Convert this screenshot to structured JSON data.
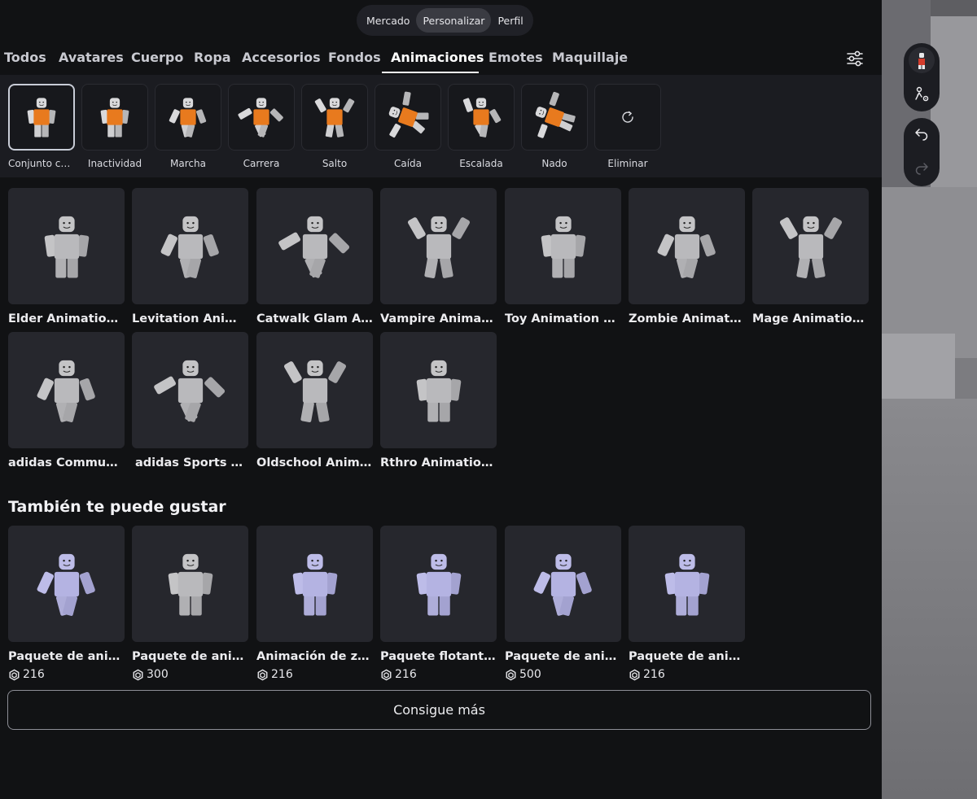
{
  "top_segment": [
    {
      "label": "Mercado",
      "active": false
    },
    {
      "label": "Personalizar",
      "active": true
    },
    {
      "label": "Perfil",
      "active": false
    }
  ],
  "category_tabs": [
    {
      "label": "Todos",
      "active": false
    },
    {
      "label": "Avatares",
      "active": false
    },
    {
      "label": "Cuerpo",
      "active": false
    },
    {
      "label": "Ropa",
      "active": false
    },
    {
      "label": "Accesorios",
      "active": false
    },
    {
      "label": "Fondos",
      "active": false
    },
    {
      "label": "Animaciones",
      "active": true
    },
    {
      "label": "Emotes",
      "active": false
    },
    {
      "label": "Maquillaje",
      "active": false
    }
  ],
  "sub_categories": [
    {
      "label": "Conjunto co...",
      "active": true
    },
    {
      "label": "Inactividad",
      "active": false
    },
    {
      "label": "Marcha",
      "active": false
    },
    {
      "label": "Carrera",
      "active": false
    },
    {
      "label": "Salto",
      "active": false
    },
    {
      "label": "Caída",
      "active": false
    },
    {
      "label": "Escalada",
      "active": false
    },
    {
      "label": "Nado",
      "active": false
    },
    {
      "label": "Eliminar",
      "active": false
    }
  ],
  "owned_items": [
    {
      "name": "Elder Animation P..."
    },
    {
      "name": "Levitation Animati..."
    },
    {
      "name": "Catwalk Glam Ani..."
    },
    {
      "name": "Vampire Animatio..."
    },
    {
      "name": "Toy Animation Pack"
    },
    {
      "name": "Zombie Animation ..."
    },
    {
      "name": "Mage Animation P..."
    },
    {
      "name": "adidas Community"
    },
    {
      "name": "adidas Sports Ani..."
    },
    {
      "name": "Oldschool Animati..."
    },
    {
      "name": "Rthro Animation P..."
    }
  ],
  "recommended": {
    "title": "También te puede gustar",
    "items": [
      {
        "name": "Paquete de anima...",
        "price": "216"
      },
      {
        "name": "Paquete de anima...",
        "price": "300"
      },
      {
        "name": "Animación de zom...",
        "price": "216"
      },
      {
        "name": "Paquete flotante ...",
        "price": "216"
      },
      {
        "name": "Paquete de anima...",
        "price": "500"
      },
      {
        "name": "Paquete de anima...",
        "price": "216"
      }
    ]
  },
  "get_more_label": "Consigue más",
  "colors": {
    "background": "#111214",
    "card": "#26272d",
    "accent_orange": "#e87a1e",
    "figure_gray": "#c4c4c6",
    "figure_lavender": "#b9b8e4"
  }
}
